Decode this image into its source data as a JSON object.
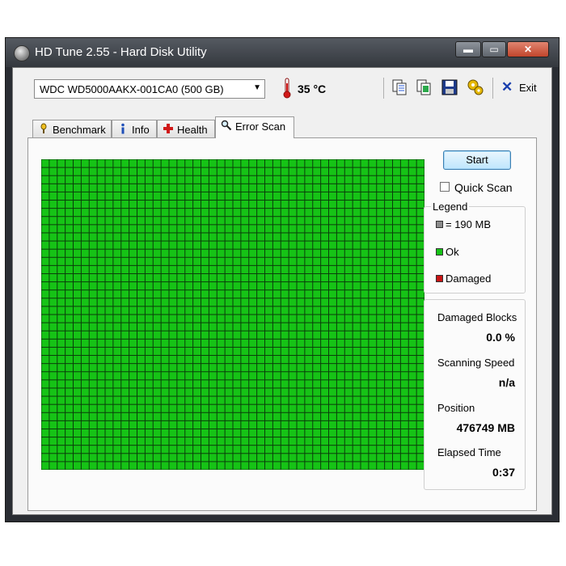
{
  "window": {
    "title": "HD Tune 2.55 - Hard Disk Utility",
    "controls": {
      "minimize": "▬",
      "maximize": "▭",
      "close": "✕"
    }
  },
  "toolbar": {
    "drive": "WDC WD5000AAKX-001CA0 (500 GB)",
    "temperature": "35 °C",
    "exit_label": "Exit",
    "icons": [
      "copy-text-icon",
      "copy-screenshot-icon",
      "save-icon",
      "options-icon"
    ]
  },
  "tabs": [
    {
      "label": "Benchmark",
      "icon": "benchmark-icon"
    },
    {
      "label": "Info",
      "icon": "info-icon"
    },
    {
      "label": "Health",
      "icon": "health-icon"
    },
    {
      "label": "Error Scan",
      "icon": "magnifier-icon",
      "active": true
    }
  ],
  "scan": {
    "start_label": "Start",
    "quick_scan_label": "Quick Scan",
    "quick_scan_checked": false,
    "grid": {
      "columns": 48,
      "rows": 38,
      "block_state": "ok"
    }
  },
  "legend": {
    "title": "Legend",
    "items": [
      {
        "label": "= 190 MB",
        "color": "#8c8c8c"
      },
      {
        "label": "Ok",
        "color": "#16c316"
      },
      {
        "label": "Damaged",
        "color": "#c81414"
      }
    ]
  },
  "stats": {
    "damaged_blocks_label": "Damaged Blocks",
    "damaged_blocks_value": "0.0 %",
    "scanning_speed_label": "Scanning Speed",
    "scanning_speed_value": "n/a",
    "position_label": "Position",
    "position_value": "476749 MB",
    "elapsed_time_label": "Elapsed Time",
    "elapsed_time_value": "0:37"
  },
  "colors": {
    "ok_block": "#16c316",
    "grid_line": "#0b3d0b",
    "accent": "#3c7fb1"
  }
}
